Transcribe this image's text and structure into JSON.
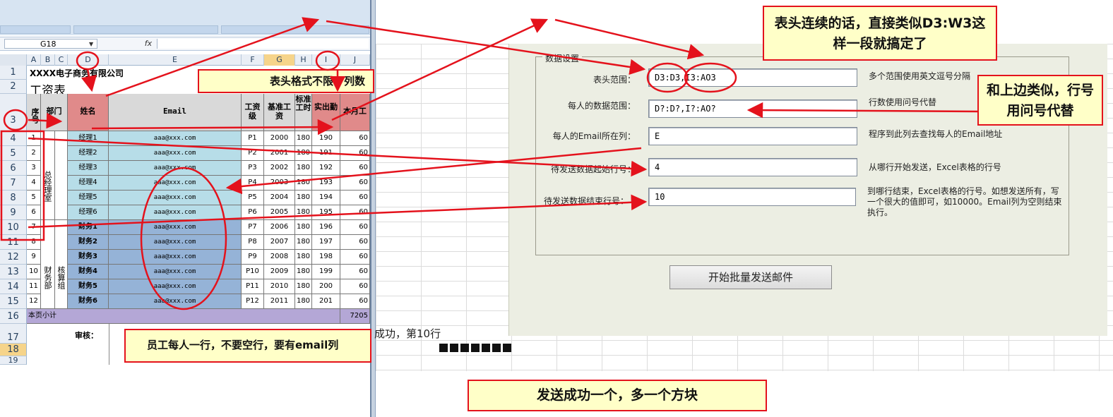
{
  "excel": {
    "name_box": "G18",
    "fx_label": "fx",
    "columns": [
      "A",
      "B",
      "C",
      "D",
      "E",
      "F",
      "G",
      "H",
      "I",
      "J"
    ],
    "rows": [
      "1",
      "2",
      "3",
      "4",
      "5",
      "6",
      "7",
      "8",
      "9",
      "10",
      "11",
      "12",
      "13",
      "14",
      "15",
      "16",
      "17",
      "18",
      "19"
    ],
    "company": "XXXX电子商务有限公司",
    "sheet_title": "工资表",
    "headers": {
      "seq": "序号",
      "dept": "部门",
      "name": "姓名",
      "email": "Email",
      "grade": "工资级",
      "base": "基准工资",
      "std": "标准工时",
      "actual": "实出勤",
      "month": "本月工"
    },
    "dept_manager": "总经理室",
    "dept_finance": "财务部",
    "dept_audit": "核算组",
    "employees": [
      {
        "seq": "1",
        "name": "经理1",
        "email": "aaa@xxx.com",
        "grade": "P1",
        "base": "2000",
        "std": "180",
        "actual": "190",
        "month": "60"
      },
      {
        "seq": "2",
        "name": "经理2",
        "email": "aaa@xxx.com",
        "grade": "P2",
        "base": "2001",
        "std": "180",
        "actual": "191",
        "month": "60"
      },
      {
        "seq": "3",
        "name": "经理3",
        "email": "aaa@xxx.com",
        "grade": "P3",
        "base": "2002",
        "std": "180",
        "actual": "192",
        "month": "60"
      },
      {
        "seq": "4",
        "name": "经理4",
        "email": "aaa@xxx.com",
        "grade": "P4",
        "base": "2003",
        "std": "180",
        "actual": "193",
        "month": "60"
      },
      {
        "seq": "5",
        "name": "经理5",
        "email": "aaa@xxx.com",
        "grade": "P5",
        "base": "2004",
        "std": "180",
        "actual": "194",
        "month": "60"
      },
      {
        "seq": "6",
        "name": "经理6",
        "email": "aaa@xxx.com",
        "grade": "P6",
        "base": "2005",
        "std": "180",
        "actual": "195",
        "month": "60"
      },
      {
        "seq": "7",
        "name": "财务1",
        "email": "aaa@xxx.com",
        "grade": "P7",
        "base": "2006",
        "std": "180",
        "actual": "196",
        "month": "60"
      },
      {
        "seq": "8",
        "name": "财务2",
        "email": "aaa@xxx.com",
        "grade": "P8",
        "base": "2007",
        "std": "180",
        "actual": "197",
        "month": "60"
      },
      {
        "seq": "9",
        "name": "财务3",
        "email": "aaa@xxx.com",
        "grade": "P9",
        "base": "2008",
        "std": "180",
        "actual": "198",
        "month": "60"
      },
      {
        "seq": "10",
        "name": "财务4",
        "email": "aaa@xxx.com",
        "grade": "P10",
        "base": "2009",
        "std": "180",
        "actual": "199",
        "month": "60"
      },
      {
        "seq": "11",
        "name": "财务5",
        "email": "aaa@xxx.com",
        "grade": "P11",
        "base": "2010",
        "std": "180",
        "actual": "200",
        "month": "60"
      },
      {
        "seq": "12",
        "name": "财务6",
        "email": "aaa@xxx.com",
        "grade": "P12",
        "base": "2011",
        "std": "180",
        "actual": "201",
        "month": "60"
      }
    ],
    "subtotal_label": "本页小计",
    "subtotal_value": "7205",
    "review_label": "审核："
  },
  "form": {
    "group_title": "数据设置",
    "fields": [
      {
        "label": "表头范围：",
        "value": "D3:D3,I3:AO3",
        "hint": "多个范围使用英文逗号分隔"
      },
      {
        "label": "每人的数据范围：",
        "value": "D?:D?,I?:AO?",
        "hint": "行数使用问号代替"
      },
      {
        "label": "每人的Email所在列：",
        "value": "E",
        "hint": "程序到此列去查找每人的Email地址"
      },
      {
        "label": "待发送数据起始行号：",
        "value": "4",
        "hint": "从哪行开始发送，Excel表格的行号"
      },
      {
        "label": "待发送数据结束行号：",
        "value": "10",
        "hint": "到哪行结束，Excel表格的行号。如想发送所有，写一个很大的值即可，如10000。Email列为空则结束执行。"
      }
    ],
    "send_button": "开始批量发送邮件",
    "status": "成功，第10行",
    "block_count": 7
  },
  "callouts": {
    "header_continuous": "表头连续的话，直接类似D3:W3这样一段就搞定了",
    "header_format": "表头格式不限，列数",
    "row_question": "和上边类似，行号用问号代替",
    "one_per_row": "员工每人一行，不要空行，要有email列",
    "one_block": "发送成功一个，多一个方块"
  },
  "colors": {
    "callout_bg": "#ffffc8",
    "callout_border": "#e4121c",
    "annotation": "#e4121c"
  }
}
